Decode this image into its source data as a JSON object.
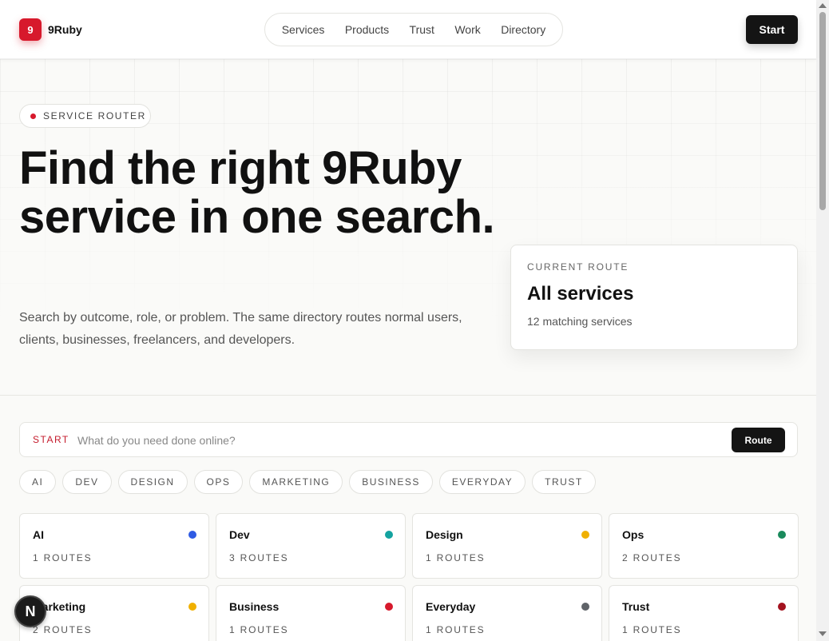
{
  "brand": {
    "badge": "9",
    "name": "9Ruby",
    "accent": "#d7192c"
  },
  "nav": {
    "items": [
      "Services",
      "Products",
      "Trust",
      "Work",
      "Directory"
    ]
  },
  "header": {
    "start_label": "Start"
  },
  "hero": {
    "pill": "SERVICE ROUTER",
    "title": "Find the right 9Ruby service in one search.",
    "description": "Search by outcome, role, or problem. The same directory routes normal users, clients, businesses, freelancers, and developers."
  },
  "current_route": {
    "label": "CURRENT ROUTE",
    "title": "All services",
    "count": "12 matching services"
  },
  "search": {
    "label": "START",
    "placeholder": "What do you need done online?",
    "value": "",
    "button": "Route"
  },
  "filters": [
    "AI",
    "DEV",
    "DESIGN",
    "OPS",
    "MARKETING",
    "BUSINESS",
    "EVERYDAY",
    "TRUST"
  ],
  "categories": [
    {
      "name": "AI",
      "routes": "1 ROUTES",
      "color": "#2f5be3"
    },
    {
      "name": "Dev",
      "routes": "3 ROUTES",
      "color": "#14a3a0"
    },
    {
      "name": "Design",
      "routes": "1 ROUTES",
      "color": "#f0b000"
    },
    {
      "name": "Ops",
      "routes": "2 ROUTES",
      "color": "#1a8a5c"
    },
    {
      "name": "Marketing",
      "routes": "2 ROUTES",
      "color": "#f0b000"
    },
    {
      "name": "Business",
      "routes": "1 ROUTES",
      "color": "#d7192c"
    },
    {
      "name": "Everyday",
      "routes": "1 ROUTES",
      "color": "#5f6368"
    },
    {
      "name": "Trust",
      "routes": "1 ROUTES",
      "color": "#a3121f"
    }
  ],
  "floating": {
    "label": "N"
  }
}
